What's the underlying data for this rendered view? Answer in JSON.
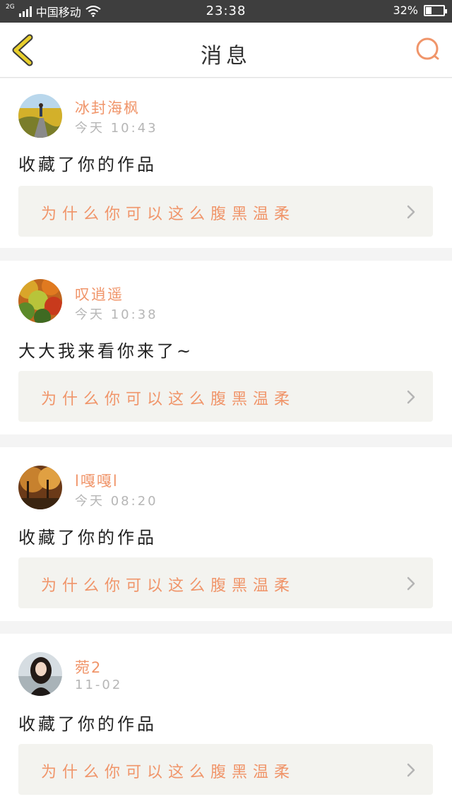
{
  "status_bar": {
    "network": "2G",
    "carrier": "中国移动",
    "time": "23:38",
    "battery": "32%",
    "battery_level": 0.32
  },
  "header": {
    "title": "消息",
    "back_icon": "chevron-left-icon",
    "search_icon": "search-icon"
  },
  "colors": {
    "accent": "#f0956a",
    "back_icon": "#e8cf2c",
    "status_bar": "#3e3e3e"
  },
  "messages": [
    {
      "user": "冰封海枫",
      "time": "今天 10:43",
      "text": "收藏了你的作品",
      "work_title": "为什么你可以这么腹黑温柔"
    },
    {
      "user": "叹逍遥",
      "time": "今天 10:38",
      "text": "大大我来看你来了~",
      "work_title": "为什么你可以这么腹黑温柔"
    },
    {
      "user": "l嘎嘎l",
      "time": "今天 08:20",
      "text": "收藏了你的作品",
      "work_title": "为什么你可以这么腹黑温柔"
    },
    {
      "user": "菀2",
      "time": "11-02",
      "text": "收藏了你的作品",
      "work_title": "为什么你可以这么腹黑温柔"
    }
  ]
}
